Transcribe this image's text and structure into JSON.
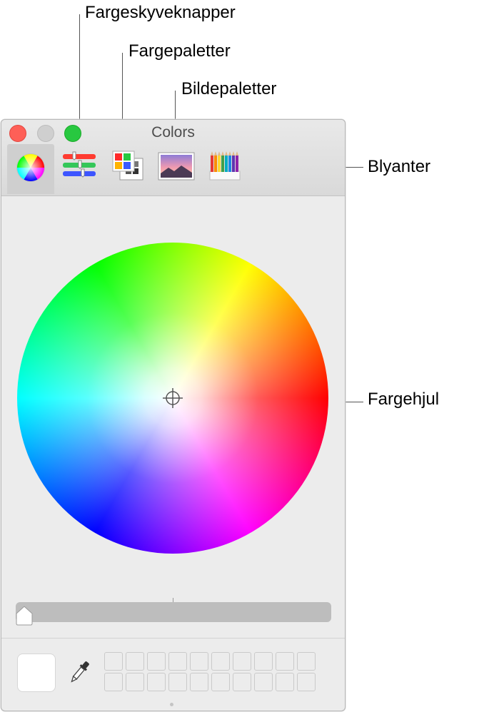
{
  "callouts": {
    "sliders": "Fargeskyveknapper",
    "palettes": "Fargepaletter",
    "image_palettes": "Bildepaletter",
    "pencils": "Blyanter",
    "wheel": "Fargehjul"
  },
  "window": {
    "title": "Colors",
    "traffic_lights": {
      "close": "#fe5f57",
      "minimize": "#cfcfcf",
      "zoom": "#28c840"
    },
    "tabs": [
      {
        "icon": "color-wheel-icon",
        "selected": true
      },
      {
        "icon": "color-sliders-icon",
        "selected": false
      },
      {
        "icon": "color-palettes-icon",
        "selected": false
      },
      {
        "icon": "image-palettes-icon",
        "selected": false
      },
      {
        "icon": "pencils-icon",
        "selected": false
      }
    ]
  },
  "brightness_slider": {
    "value_fraction": 0.0
  },
  "current_color": "#ffffff",
  "swatch_grid": {
    "rows": 2,
    "columns": 10
  }
}
